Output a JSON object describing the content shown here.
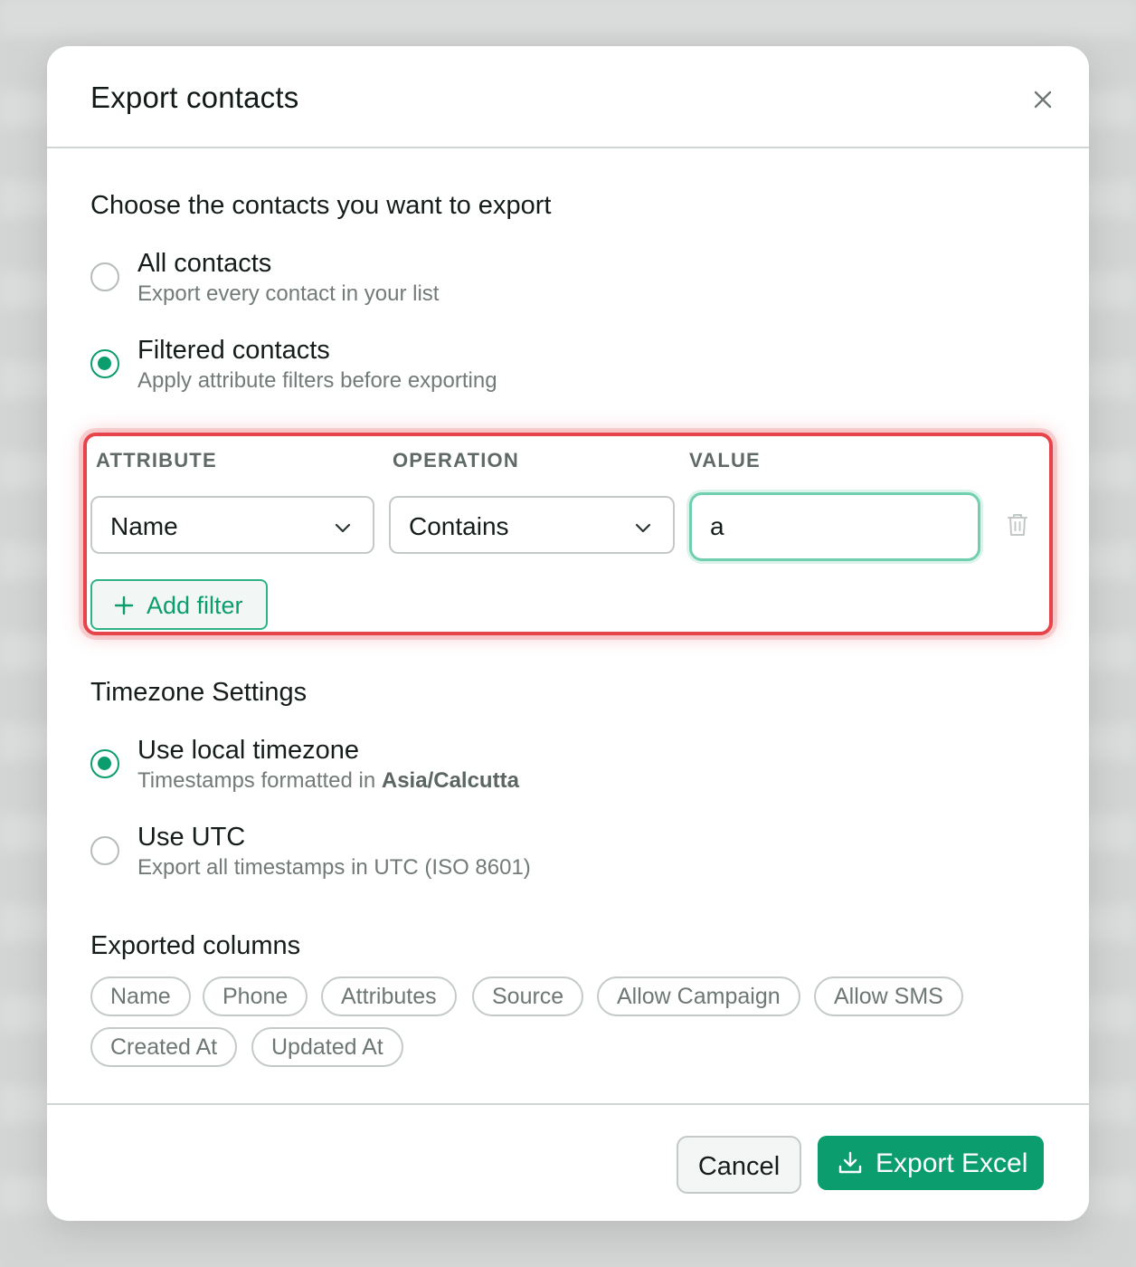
{
  "dialog": {
    "title": "Export contacts"
  },
  "contacts_section": {
    "title": "Choose the contacts you want to export",
    "options": [
      {
        "label": "All contacts",
        "description": "Export every contact in your list",
        "selected": false
      },
      {
        "label": "Filtered contacts",
        "description": "Apply attribute filters before exporting",
        "selected": true
      }
    ]
  },
  "filters": {
    "headers": {
      "attribute": "ATTRIBUTE",
      "operation": "OPERATION",
      "value": "VALUE"
    },
    "rows": [
      {
        "attribute": "Name",
        "operation": "Contains",
        "value": "a"
      }
    ],
    "add_label": "Add filter"
  },
  "timezone_section": {
    "title": "Timezone Settings",
    "local": {
      "label": "Use local timezone",
      "description_prefix": "Timestamps formatted in",
      "timezone": "Asia/Calcutta",
      "selected": true
    },
    "utc": {
      "label": "Use UTC",
      "description": "Export all timestamps in UTC (ISO 8601)",
      "selected": false
    }
  },
  "columns_section": {
    "title": "Exported columns",
    "chips": [
      "Name",
      "Phone",
      "Attributes",
      "Source",
      "Allow Campaign",
      "Allow SMS",
      "Created At",
      "Updated At"
    ]
  },
  "footer": {
    "cancel_label": "Cancel",
    "export_label": "Export Excel"
  },
  "colors": {
    "accent": "#0c9d6e",
    "highlight_border": "#e6434a",
    "focus_border": "#6fcfae"
  }
}
